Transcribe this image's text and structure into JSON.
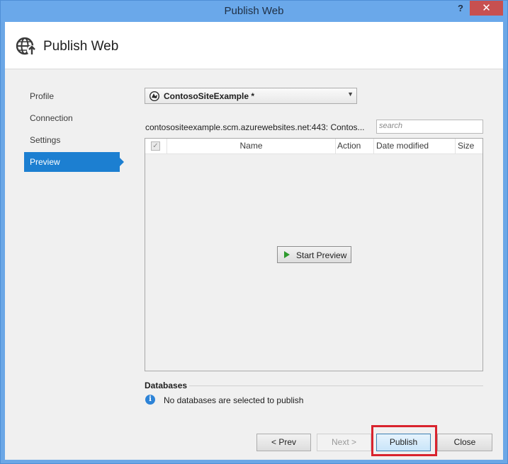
{
  "window": {
    "title": "Publish Web",
    "help": "?",
    "close": "✕"
  },
  "header": {
    "title": "Publish Web",
    "icon": "globe-publish-icon"
  },
  "nav": {
    "items": [
      {
        "label": "Profile",
        "active": false
      },
      {
        "label": "Connection",
        "active": false
      },
      {
        "label": "Settings",
        "active": false
      },
      {
        "label": "Preview",
        "active": true
      }
    ]
  },
  "profile": {
    "selected": "ContosoSiteExample *",
    "icon": "azure-icon"
  },
  "target": {
    "url": "contosositeexample.scm.azurewebsites.net:443: Contos...",
    "search_placeholder": "search"
  },
  "grid": {
    "columns": [
      "Name",
      "Action",
      "Date modified",
      "Size"
    ],
    "check_all": "✓",
    "start_preview": "Start Preview"
  },
  "databases": {
    "title": "Databases",
    "message": "No databases are selected to publish"
  },
  "footer": {
    "prev": "< Prev",
    "next": "Next >",
    "publish": "Publish",
    "close": "Close"
  },
  "colors": {
    "accent": "#1c7fd1",
    "titlebar": "#6aa8ea",
    "highlight": "#d9232d"
  }
}
